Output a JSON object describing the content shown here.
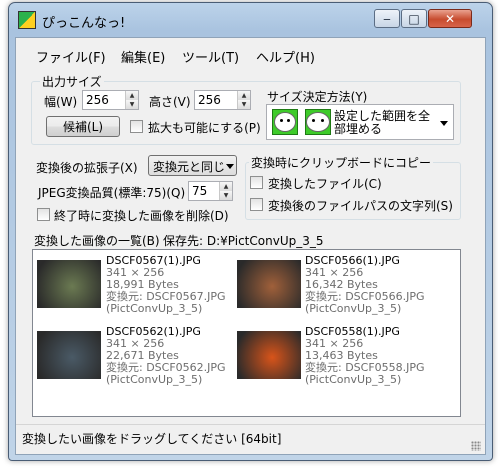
{
  "window": {
    "title": "ぴっこんなっ!"
  },
  "menu": [
    "ファイル(F)",
    "編集(E)",
    "ツール(T)",
    "ヘルプ(H)"
  ],
  "output_size": {
    "label": "出力サイズ",
    "width_label": "幅(W)",
    "width_value": "256",
    "height_label": "高さ(V)",
    "height_value": "256",
    "candidates_button": "候補(L)",
    "allow_enlarge_label": "拡大も可能にする(P)"
  },
  "size_method": {
    "label": "サイズ決定方法(Y)",
    "selected": "設定した範囲を全部埋める"
  },
  "extension": {
    "label": "変換後の拡張子(X)",
    "value": "変換元と同じ"
  },
  "jpeg_quality": {
    "label": "JPEG変換品質(標準:75)(Q)",
    "value": "75"
  },
  "delete_on_exit_label": "終了時に変換した画像を削除(D)",
  "clipboard": {
    "label": "変換時にクリップボードにコピー",
    "copy_file_label": "変換したファイル(C)",
    "copy_path_label": "変換後のファイルパスの文字列(S)"
  },
  "list": {
    "label": "変換した画像の一覧(B)",
    "save_dir_label": "保存先: D:¥PictConvUp_3_5",
    "items": [
      {
        "name": "DSCF0567(1).JPG",
        "dims": "341 × 256",
        "size": "18,991 Bytes",
        "source": "変換元: DSCF0567.JPG",
        "folder": "(PictConvUp_3_5)",
        "color": "#6b7a52"
      },
      {
        "name": "DSCF0566(1).JPG",
        "dims": "341 × 256",
        "size": "16,342 Bytes",
        "source": "変換元: DSCF0566.JPG",
        "folder": "(PictConvUp_3_5)",
        "color": "#a0603a"
      },
      {
        "name": "DSCF0562(1).JPG",
        "dims": "341 × 256",
        "size": "22,671 Bytes",
        "source": "変換元: DSCF0562.JPG",
        "folder": "(PictConvUp_3_5)",
        "color": "#4a5a66"
      },
      {
        "name": "DSCF0558(1).JPG",
        "dims": "341 × 256",
        "size": "13,463 Bytes",
        "source": "変換元: DSCF0558.JPG",
        "folder": "(PictConvUp_3_5)",
        "color": "#d8541a"
      }
    ]
  },
  "status": "変換したい画像をドラッグしてください [64bit]"
}
